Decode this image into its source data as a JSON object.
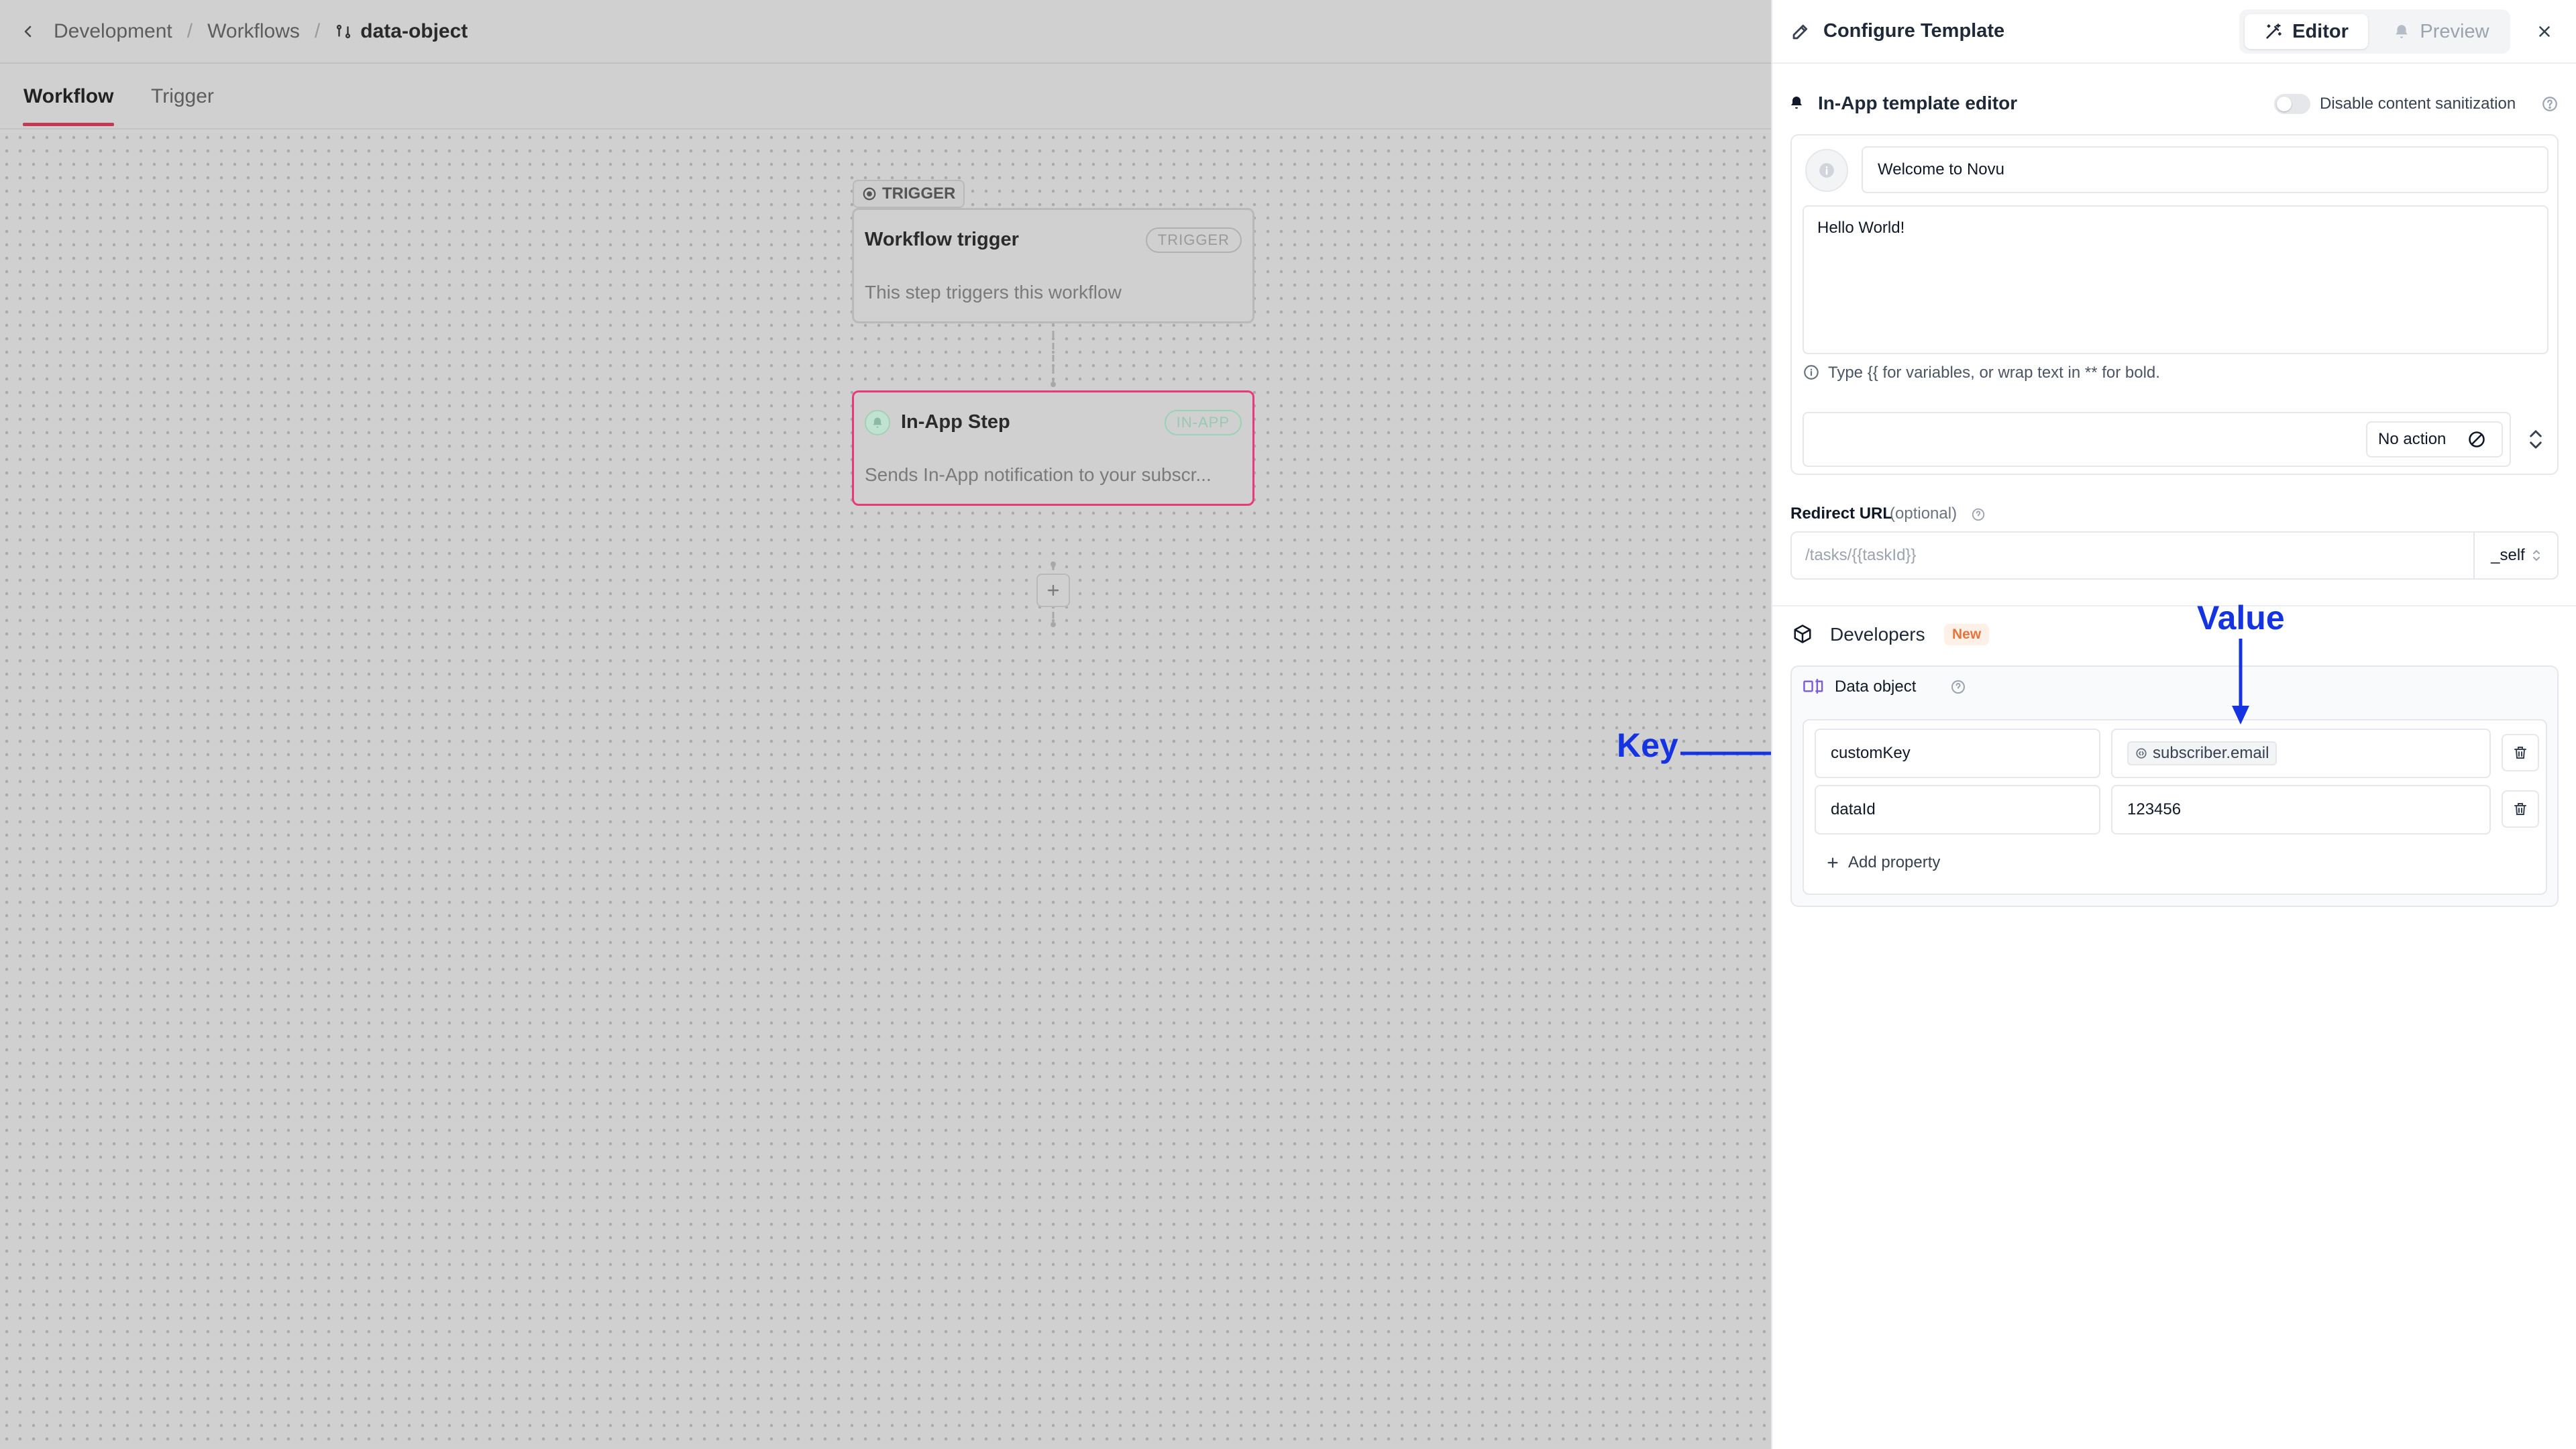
{
  "breadcrumb": {
    "items": [
      "Development",
      "Workflows"
    ],
    "current": "data-object"
  },
  "tabs": [
    "Workflow",
    "Trigger"
  ],
  "workflow": {
    "trigger_label": "TRIGGER",
    "trigger_node": {
      "title": "Workflow trigger",
      "badge": "TRIGGER",
      "subtitle": "This step triggers this workflow"
    },
    "inapp_node": {
      "title": "In-App Step",
      "badge": "IN-APP",
      "subtitle": "Sends In-App notification to your subscr..."
    }
  },
  "panel": {
    "title": "Configure Template",
    "editor_tab": "Editor",
    "preview_tab": "Preview",
    "editor_title": "In-App template editor",
    "sanitize_label": "Disable content sanitization",
    "subject_value": "Welcome to Novu",
    "body_value": "Hello World!",
    "hint": "Type {{ for variables, or wrap text in ** for bold.",
    "action_label": "No action",
    "redirect_label": "Redirect URL",
    "redirect_optional": "(optional)",
    "redirect_placeholder": "/tasks/{{taskId}}",
    "redirect_target": "_self",
    "developers_title": "Developers",
    "new_badge": "New",
    "data_object_title": "Data object",
    "properties": [
      {
        "key": "customKey",
        "value": "subscriber.email",
        "value_is_variable": true
      },
      {
        "key": "dataId",
        "value": "123456",
        "value_is_variable": false
      }
    ],
    "add_property": "Add property"
  },
  "annotations": {
    "key_label": "Key",
    "value_label": "Value",
    "color": "#1533e0"
  },
  "colors": {
    "accent": "#c43a55",
    "inapp_border": "#e83a78",
    "new_badge": "#e8743b"
  }
}
